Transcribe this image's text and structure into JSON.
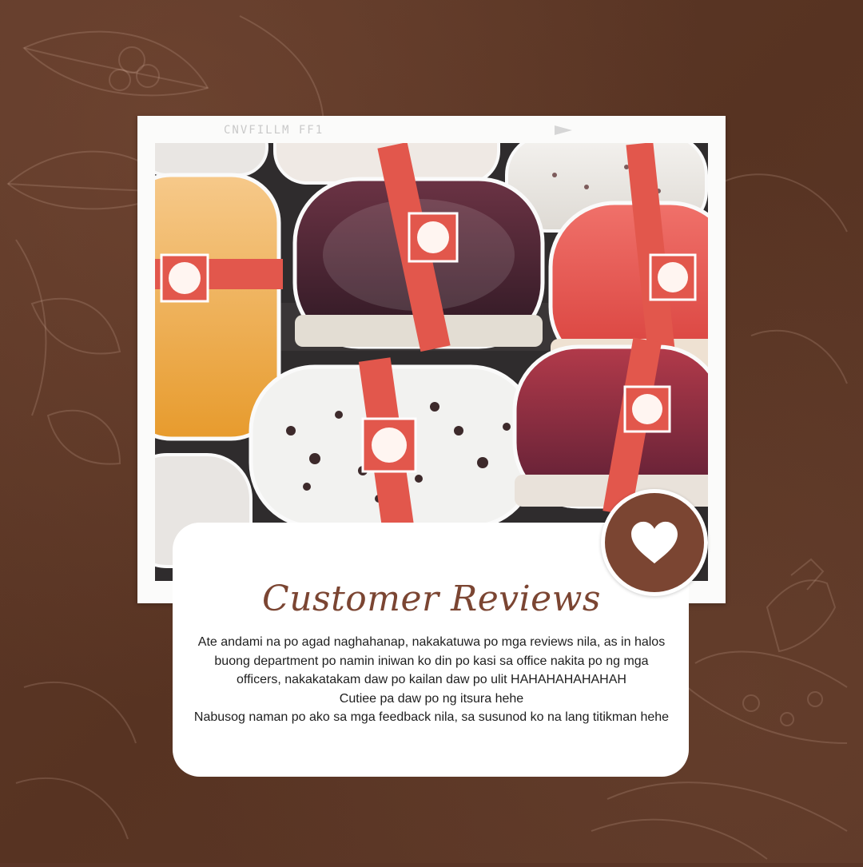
{
  "photo_frame": {
    "film_label": "CNVFILLM FF1"
  },
  "review": {
    "title": "Customer Reviews",
    "lines": [
      "Ate andami na po agad naghahanap, nakakatuwa po mga reviews nila, as in halos buong department po namin iniwan ko din po kasi sa office nakita po ng mga officers, nakakatakam daw po kailan daw po ulit HAHAHAHAHAHAH",
      "Cutiee pa daw po ng itsura hehe",
      "Nabusog naman po ako sa mga feedback nila, sa susunod ko na lang titikman hehe"
    ]
  },
  "badge": {
    "icon": "heart-icon"
  },
  "colors": {
    "background": "#5a3526",
    "accent": "#7b4532",
    "card": "#ffffff"
  }
}
